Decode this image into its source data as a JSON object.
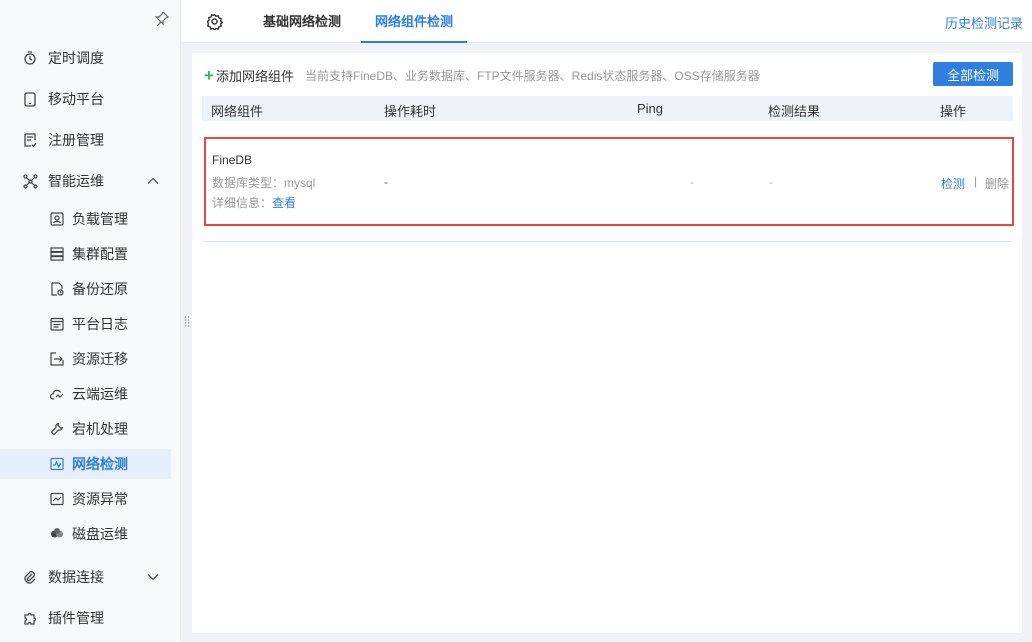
{
  "sidebar": {
    "items": [
      {
        "label": "定时调度",
        "icon": "timer-icon"
      },
      {
        "label": "移动平台",
        "icon": "mobile-icon"
      },
      {
        "label": "注册管理",
        "icon": "register-icon"
      },
      {
        "label": "智能运维",
        "icon": "ops-icon",
        "expanded": true
      },
      {
        "label": "数据连接",
        "icon": "link-icon",
        "expanded": false
      },
      {
        "label": "插件管理",
        "icon": "plugin-icon"
      }
    ],
    "sub_items": [
      {
        "label": "负载管理",
        "icon": "load-icon"
      },
      {
        "label": "集群配置",
        "icon": "cluster-icon"
      },
      {
        "label": "备份还原",
        "icon": "backup-icon"
      },
      {
        "label": "平台日志",
        "icon": "log-icon"
      },
      {
        "label": "资源迁移",
        "icon": "migrate-icon"
      },
      {
        "label": "云端运维",
        "icon": "cloud-icon"
      },
      {
        "label": "宕机处理",
        "icon": "wrench-icon"
      },
      {
        "label": "网络检测",
        "icon": "network-icon",
        "active": true
      },
      {
        "label": "资源异常",
        "icon": "anomaly-icon"
      },
      {
        "label": "磁盘运维",
        "icon": "disk-icon"
      }
    ]
  },
  "header": {
    "tabs": [
      {
        "label": "基础网络检测",
        "active": false
      },
      {
        "label": "网络组件检测",
        "active": true
      }
    ],
    "history_link": "历史检测记录"
  },
  "toolbar": {
    "add_label": "添加网络组件",
    "support_text": "当前支持FineDB、业务数据库、FTP文件服务器、Redis状态服务器、OSS存储服务器",
    "detect_all_label": "全部检测"
  },
  "table": {
    "columns": [
      "网络组件",
      "操作耗时",
      "Ping",
      "检测结果",
      "操作"
    ],
    "rows": [
      {
        "name": "FineDB",
        "meta": "数据库类型：mysql",
        "detail_label": "详细信息：",
        "detail_link": "查看",
        "duration": "-",
        "ping": "-",
        "result": "-",
        "action_detect": "检测",
        "action_sep": "|",
        "action_delete": "删除"
      }
    ]
  },
  "colors": {
    "accent": "#2f7fe0",
    "highlight_border": "#e8463f",
    "add_plus": "#3db36b",
    "active_bg": "#e6eefb"
  }
}
